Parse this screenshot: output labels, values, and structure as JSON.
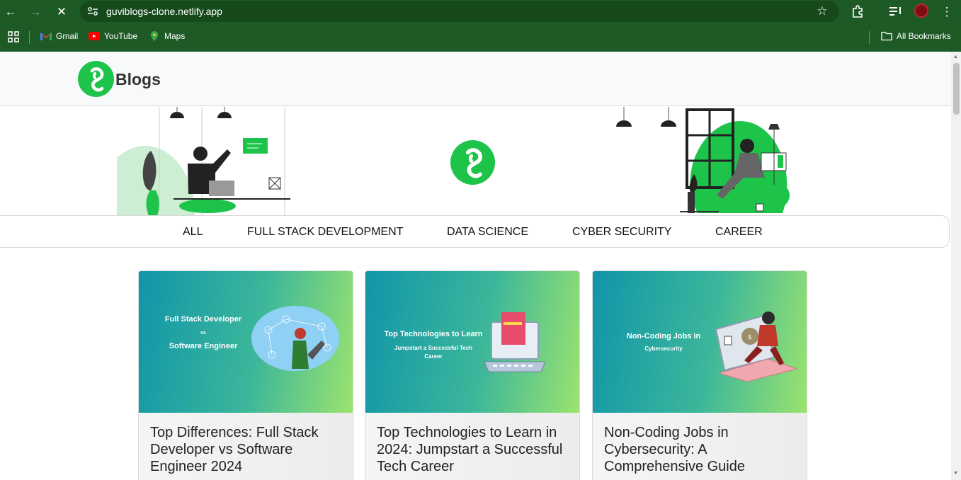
{
  "browser": {
    "url": "guviblogs-clone.netlify.app",
    "bookmarks": [
      {
        "label": "Gmail",
        "icon": "gmail-icon"
      },
      {
        "label": "YouTube",
        "icon": "youtube-icon"
      },
      {
        "label": "Maps",
        "icon": "maps-icon"
      }
    ],
    "all_bookmarks_label": "All Bookmarks"
  },
  "header": {
    "logo_text": "Blogs",
    "brand_color": "#1ec44a"
  },
  "nav": {
    "items": [
      "ALL",
      "FULL STACK DEVELOPMENT",
      "DATA SCIENCE",
      "CYBER SECURITY",
      "CAREER"
    ]
  },
  "cards": [
    {
      "image_line1": "Full Stack Developer",
      "image_line2": "vs",
      "image_line3": "Software Engineer",
      "title": "Top Differences: Full Stack Developer vs Software Engineer 2024"
    },
    {
      "image_line1": "Top Technologies to Learn",
      "image_line2": "Jumpstart a Successful Tech",
      "image_line3": "Career",
      "title": "Top Technologies to Learn in 2024: Jumpstart a Successful Tech Career"
    },
    {
      "image_line1": "Non-Coding Jobs in",
      "image_line2": "Cybersecurity",
      "title": "Non-Coding Jobs in Cybersecurity: A Comprehensive Guide"
    }
  ]
}
